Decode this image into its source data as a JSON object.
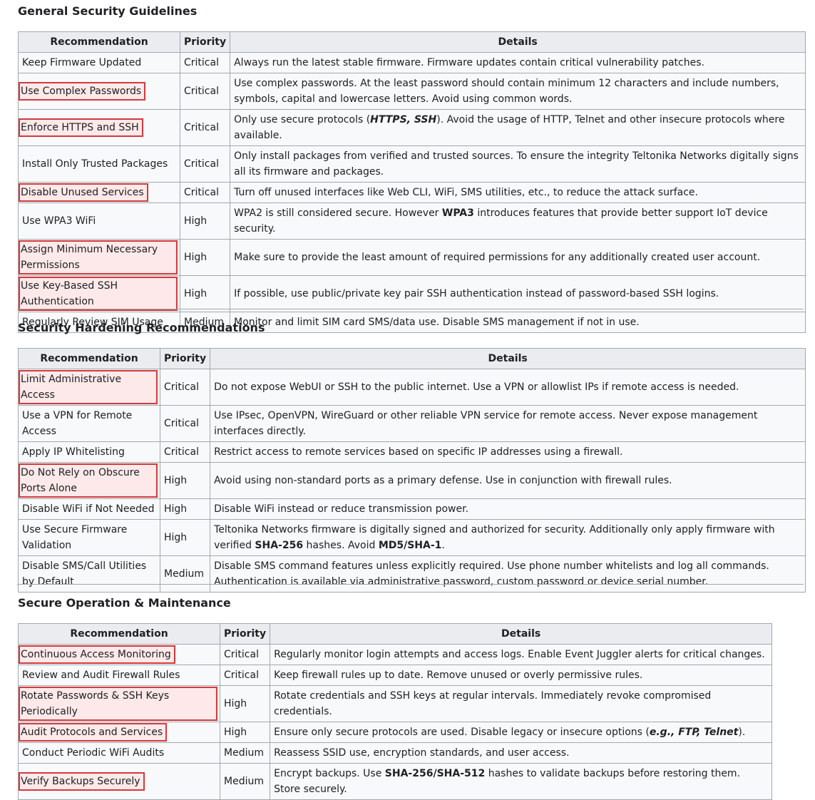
{
  "sections": [
    {
      "title": "General Security Guidelines",
      "headers": [
        "Recommendation",
        "Priority",
        "Details"
      ],
      "rows": [
        {
          "rec": "Keep Firmware Updated",
          "hl": false,
          "priority": "Critical",
          "details": "Always run the latest stable firmware. Firmware updates contain critical vulnerability patches."
        },
        {
          "rec": "Use Complex Passwords",
          "hl": true,
          "priority": "Critical",
          "details": "Use complex passwords. At the least password should contain minimum 12 characters and include numbers, symbols, capital and lowercase letters. Avoid using common words."
        },
        {
          "rec": "Enforce HTTPS and SSH",
          "hl": true,
          "priority": "Critical",
          "details": "Only use secure protocols (<b><i>HTTPS, SSH</i></b>). Avoid the usage of HTTP, Telnet and other insecure protocols where available."
        },
        {
          "rec": "Install Only Trusted Packages",
          "hl": false,
          "priority": "Critical",
          "details": "Only install packages from verified and trusted sources. To ensure the integrity Teltonika Networks digitally signs all its firmware and packages."
        },
        {
          "rec": "Disable Unused Services",
          "hl": true,
          "priority": "Critical",
          "details": "Turn off unused interfaces like Web CLI, WiFi, SMS utilities, etc., to reduce the attack surface."
        },
        {
          "rec": "Use WPA3 WiFi",
          "hl": false,
          "priority": "High",
          "details": "WPA2 is still considered secure. However <b>WPA3</b> introduces features that provide better support IoT device security."
        },
        {
          "rec": "Assign Minimum Necessary Permissions",
          "hl": true,
          "priority": "High",
          "details": "Make sure to provide the least amount of required permissions for any additionally created user account."
        },
        {
          "rec": "Use Key-Based SSH Authentication",
          "hl": true,
          "priority": "High",
          "details": "If possible, use public/private key pair SSH authentication instead of password-based SSH logins."
        },
        {
          "rec": "Regularly Review SIM Usage",
          "hl": false,
          "priority": "Medium",
          "details": "Monitor and limit SIM card SMS/data use. Disable SMS management if not in use."
        }
      ]
    },
    {
      "title": "Security Hardening Recommendations",
      "headers": [
        "Recommendation",
        "Priority",
        "Details"
      ],
      "rows": [
        {
          "rec": "Limit Administrative Access",
          "hl": true,
          "priority": "Critical",
          "details": "Do not expose WebUI or SSH to the public internet. Use a VPN or allowlist IPs if remote access is needed."
        },
        {
          "rec": "Use a VPN for Remote Access",
          "hl": false,
          "priority": "Critical",
          "details": "Use IPsec, OpenVPN, WireGuard or other reliable VPN service for remote access. Never expose management interfaces directly."
        },
        {
          "rec": "Apply IP Whitelisting",
          "hl": false,
          "priority": "Critical",
          "details": "Restrict access to remote services based on specific IP addresses using a firewall."
        },
        {
          "rec": "Do Not Rely on Obscure Ports Alone",
          "hl": true,
          "priority": "High",
          "details": "Avoid using non-standard ports as a primary defense. Use in conjunction with firewall rules."
        },
        {
          "rec": "Disable WiFi if Not Needed",
          "hl": false,
          "priority": "High",
          "details": "Disable WiFi instead or reduce transmission power."
        },
        {
          "rec": "Use Secure Firmware Validation",
          "hl": false,
          "priority": "High",
          "details": "Teltonika Networks firmware is digitally signed and authorized for security. Additionally only apply firmware with verified <b>SHA-256</b> hashes. Avoid <b>MD5/SHA-1</b>."
        },
        {
          "rec": "Disable SMS/Call Utilities by Default",
          "hl": false,
          "priority": "Medium",
          "details": "Disable SMS command features unless explicitly required. Use phone number whitelists and log all commands. Authentication is available via administrative password, custom password or device serial number."
        }
      ]
    },
    {
      "title": "Secure Operation & Maintenance",
      "headers": [
        "Recommendation",
        "Priority",
        "Details"
      ],
      "rows": [
        {
          "rec": "Continuous Access Monitoring",
          "hl": true,
          "priority": "Critical",
          "details": "Regularly monitor login attempts and access logs. Enable Event Juggler alerts for critical changes."
        },
        {
          "rec": "Review and Audit Firewall Rules",
          "hl": false,
          "priority": "Critical",
          "details": "Keep firewall rules up to date. Remove unused or overly permissive rules."
        },
        {
          "rec": "Rotate Passwords & SSH Keys Periodically",
          "hl": true,
          "priority": "High",
          "details": "Rotate credentials and SSH keys at regular intervals. Immediately revoke compromised credentials."
        },
        {
          "rec": "Audit Protocols and Services",
          "hl": true,
          "priority": "High",
          "details": "Ensure only secure protocols are used. Disable legacy or insecure options (<b><i>e.g., FTP, Telnet</i></b>)."
        },
        {
          "rec": "Conduct Periodic WiFi Audits",
          "hl": false,
          "priority": "Medium",
          "details": "Reassess SSID use, encryption standards, and user access."
        },
        {
          "rec": "Verify Backups Securely",
          "hl": true,
          "priority": "Medium",
          "details": "Encrypt backups. Use <b>SHA-256/SHA-512</b> hashes to validate backups before restoring them. Store securely."
        }
      ]
    }
  ],
  "colors": {
    "highlight_border": "#d33a3a",
    "highlight_fill": "#fde9ea",
    "header_bg": "#eaecf0",
    "cell_bg": "#f8f9fa",
    "border": "#a2a9b1"
  }
}
